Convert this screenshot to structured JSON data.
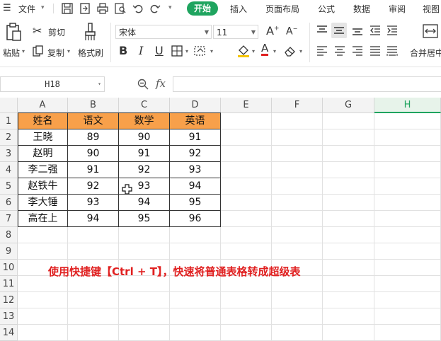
{
  "menu": {
    "file": "文件",
    "tabs": [
      "开始",
      "插入",
      "页面布局",
      "公式",
      "数据",
      "审阅",
      "视图"
    ]
  },
  "ribbon": {
    "cut": "剪切",
    "paste": "粘贴",
    "copy": "复制",
    "format_painter": "格式刷",
    "font_name": "宋体",
    "font_size": "11",
    "merge_center": "合并居中"
  },
  "formula_bar": {
    "name_box": "H18",
    "fx": "fx",
    "formula": ""
  },
  "sheet": {
    "columns": [
      "A",
      "B",
      "C",
      "D",
      "E",
      "F",
      "G",
      "H"
    ],
    "selected_column": "H",
    "rows": [
      "1",
      "2",
      "3",
      "4",
      "5",
      "6",
      "7",
      "8",
      "9",
      "10",
      "11",
      "12",
      "13",
      "14"
    ],
    "table_header": [
      "姓名",
      "语文",
      "数学",
      "英语"
    ],
    "table_rows": [
      [
        "王晓",
        "89",
        "90",
        "91"
      ],
      [
        "赵明",
        "90",
        "91",
        "92"
      ],
      [
        "李二强",
        "91",
        "92",
        "93"
      ],
      [
        "赵铁牛",
        "92",
        "93",
        "94"
      ],
      [
        "李大锤",
        "93",
        "94",
        "95"
      ],
      [
        "高在上",
        "94",
        "95",
        "96"
      ]
    ]
  },
  "note": "使用快捷键【Ctrl + T】，快速将普通表格转成超级表",
  "colors": {
    "accent": "#1fa45f",
    "header_fill": "#f8a04a",
    "note": "#e02020"
  }
}
